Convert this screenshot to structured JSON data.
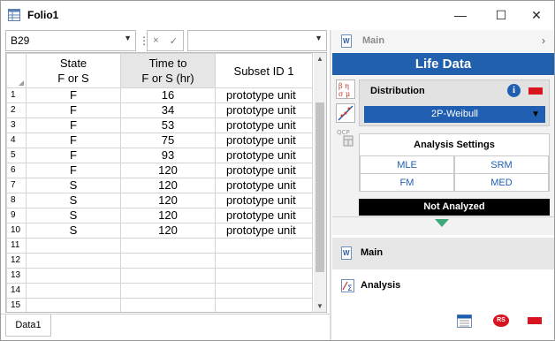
{
  "window": {
    "title": "Folio1",
    "minimize_label": "—",
    "maximize_label": "☐",
    "close_label": "✕"
  },
  "formula_bar": {
    "cell_reference": "B29",
    "cancel_label": "×",
    "confirm_label": "✓",
    "formula_value": ""
  },
  "sheet": {
    "columns": [
      {
        "line1": "State",
        "line2": "F or S"
      },
      {
        "line1": "Time to",
        "line2": "F or S (hr)"
      },
      {
        "line1": "Subset ID 1",
        "line2": ""
      }
    ],
    "rows": [
      {
        "n": "1",
        "state": "F",
        "time": "16",
        "subset": "prototype unit"
      },
      {
        "n": "2",
        "state": "F",
        "time": "34",
        "subset": "prototype unit"
      },
      {
        "n": "3",
        "state": "F",
        "time": "53",
        "subset": "prototype unit"
      },
      {
        "n": "4",
        "state": "F",
        "time": "75",
        "subset": "prototype unit"
      },
      {
        "n": "5",
        "state": "F",
        "time": "93",
        "subset": "prototype unit"
      },
      {
        "n": "6",
        "state": "F",
        "time": "120",
        "subset": "prototype unit"
      },
      {
        "n": "7",
        "state": "S",
        "time": "120",
        "subset": "prototype unit"
      },
      {
        "n": "8",
        "state": "S",
        "time": "120",
        "subset": "prototype unit"
      },
      {
        "n": "9",
        "state": "S",
        "time": "120",
        "subset": "prototype unit"
      },
      {
        "n": "10",
        "state": "S",
        "time": "120",
        "subset": "prototype unit"
      },
      {
        "n": "11",
        "state": "",
        "time": "",
        "subset": ""
      },
      {
        "n": "12",
        "state": "",
        "time": "",
        "subset": ""
      },
      {
        "n": "13",
        "state": "",
        "time": "",
        "subset": ""
      },
      {
        "n": "14",
        "state": "",
        "time": "",
        "subset": ""
      },
      {
        "n": "15",
        "state": "",
        "time": "",
        "subset": ""
      }
    ],
    "tab_label": "Data1"
  },
  "panel": {
    "header_label": "Main",
    "title": "Life Data",
    "distribution_label": "Distribution",
    "distribution_value": "2P-Weibull",
    "analysis_settings_title": "Analysis Settings",
    "settings": [
      "MLE",
      "SRM",
      "FM",
      "MED"
    ],
    "status": "Not Analyzed",
    "nav_main": "Main",
    "nav_analysis": "Analysis",
    "rs_badge": "RS"
  },
  "colors": {
    "accent_blue": "#2060ad",
    "status_red": "#d7141f",
    "status_green": "#3fa87a"
  }
}
